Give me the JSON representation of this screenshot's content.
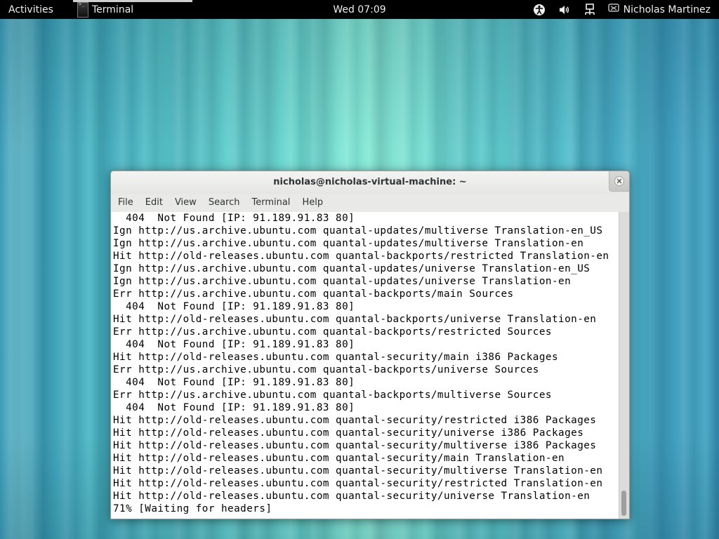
{
  "top_panel": {
    "activities_label": "Activities",
    "app_name": "Terminal",
    "clock": "Wed 07:09",
    "icons": [
      "accessibility-icon",
      "volume-icon",
      "network-icon",
      "chat-status-icon"
    ],
    "user_name": "Nicholas Martinez"
  },
  "terminal": {
    "title": "nicholas@nicholas-virtual-machine: ~",
    "menu": [
      "File",
      "Edit",
      "View",
      "Search",
      "Terminal",
      "Help"
    ],
    "output_lines": [
      "  404  Not Found [IP: 91.189.91.83 80]",
      "Ign http://us.archive.ubuntu.com quantal-updates/multiverse Translation-en_US",
      "Ign http://us.archive.ubuntu.com quantal-updates/multiverse Translation-en",
      "Hit http://old-releases.ubuntu.com quantal-backports/restricted Translation-en",
      "Ign http://us.archive.ubuntu.com quantal-updates/universe Translation-en_US",
      "Ign http://us.archive.ubuntu.com quantal-updates/universe Translation-en",
      "Err http://us.archive.ubuntu.com quantal-backports/main Sources",
      "  404  Not Found [IP: 91.189.91.83 80]",
      "Hit http://old-releases.ubuntu.com quantal-backports/universe Translation-en",
      "Err http://us.archive.ubuntu.com quantal-backports/restricted Sources",
      "  404  Not Found [IP: 91.189.91.83 80]",
      "Hit http://old-releases.ubuntu.com quantal-security/main i386 Packages",
      "Err http://us.archive.ubuntu.com quantal-backports/universe Sources",
      "  404  Not Found [IP: 91.189.91.83 80]",
      "Err http://us.archive.ubuntu.com quantal-backports/multiverse Sources",
      "  404  Not Found [IP: 91.189.91.83 80]",
      "Hit http://old-releases.ubuntu.com quantal-security/restricted i386 Packages",
      "Hit http://old-releases.ubuntu.com quantal-security/universe i386 Packages",
      "Hit http://old-releases.ubuntu.com quantal-security/multiverse i386 Packages",
      "Hit http://old-releases.ubuntu.com quantal-security/main Translation-en",
      "Hit http://old-releases.ubuntu.com quantal-security/multiverse Translation-en",
      "Hit http://old-releases.ubuntu.com quantal-security/restricted Translation-en",
      "Hit http://old-releases.ubuntu.com quantal-security/universe Translation-en",
      "71% [Waiting for headers]"
    ]
  }
}
